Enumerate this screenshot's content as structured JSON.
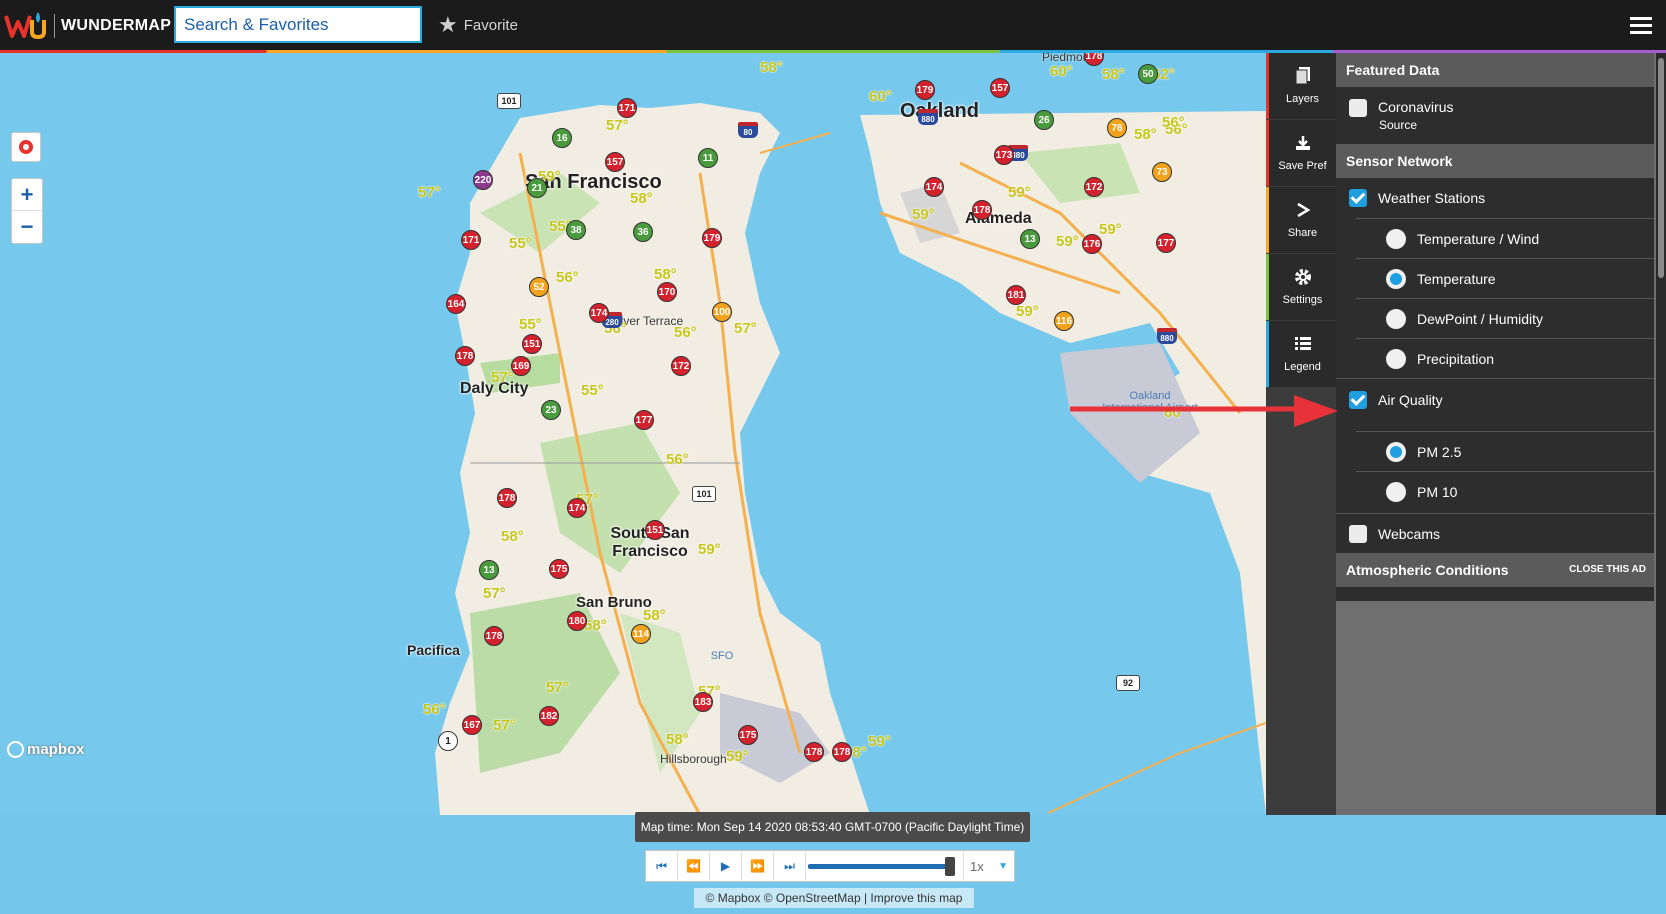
{
  "header": {
    "brand": "WUNDERMAP",
    "search_placeholder": "Search & Favorites",
    "favorite_label": "Favorite"
  },
  "map": {
    "cities": [
      {
        "name": "San Francisco",
        "size": 20
      },
      {
        "name": "Oakland",
        "size": 20
      },
      {
        "name": "Alameda",
        "size": 16
      },
      {
        "name": "Daly City",
        "size": 16
      },
      {
        "name": "South San Francisco",
        "size": 16
      },
      {
        "name": "San Bruno",
        "size": 15
      },
      {
        "name": "Pacifica",
        "size": 14
      }
    ],
    "small_labels": [
      "Silver Terrace",
      "Piedmont",
      "Hillsborough"
    ],
    "airports": [
      "Oakland International Airport",
      "SFO"
    ],
    "markers": [
      {
        "v": "171",
        "c": "red"
      },
      {
        "v": "16",
        "c": "green"
      },
      {
        "v": "157",
        "c": "red"
      },
      {
        "v": "11",
        "c": "green"
      },
      {
        "v": "220",
        "c": "purple"
      },
      {
        "v": "21",
        "c": "green"
      },
      {
        "v": "171",
        "c": "red"
      },
      {
        "v": "38",
        "c": "green"
      },
      {
        "v": "36",
        "c": "green"
      },
      {
        "v": "179",
        "c": "red"
      },
      {
        "v": "52",
        "c": "orange"
      },
      {
        "v": "170",
        "c": "red"
      },
      {
        "v": "164",
        "c": "red"
      },
      {
        "v": "174",
        "c": "red"
      },
      {
        "v": "100",
        "c": "orange"
      },
      {
        "v": "151",
        "c": "red"
      },
      {
        "v": "178",
        "c": "red"
      },
      {
        "v": "169",
        "c": "red"
      },
      {
        "v": "172",
        "c": "red"
      },
      {
        "v": "23",
        "c": "green"
      },
      {
        "v": "177",
        "c": "red"
      },
      {
        "v": "178",
        "c": "red"
      },
      {
        "v": "174",
        "c": "red"
      },
      {
        "v": "151",
        "c": "red"
      },
      {
        "v": "13",
        "c": "green"
      },
      {
        "v": "175",
        "c": "red"
      },
      {
        "v": "180",
        "c": "red"
      },
      {
        "v": "114",
        "c": "orange"
      },
      {
        "v": "178",
        "c": "red"
      },
      {
        "v": "167",
        "c": "red"
      },
      {
        "v": "182",
        "c": "red"
      },
      {
        "v": "183",
        "c": "red"
      },
      {
        "v": "175",
        "c": "red"
      },
      {
        "v": "178",
        "c": "red"
      },
      {
        "v": "178",
        "c": "red"
      },
      {
        "v": "179",
        "c": "red"
      },
      {
        "v": "157",
        "c": "red"
      },
      {
        "v": "178",
        "c": "red"
      },
      {
        "v": "50",
        "c": "green"
      },
      {
        "v": "26",
        "c": "green"
      },
      {
        "v": "76",
        "c": "orange"
      },
      {
        "v": "173",
        "c": "red"
      },
      {
        "v": "73",
        "c": "orange"
      },
      {
        "v": "174",
        "c": "red"
      },
      {
        "v": "178",
        "c": "red"
      },
      {
        "v": "172",
        "c": "red"
      },
      {
        "v": "13",
        "c": "green"
      },
      {
        "v": "176",
        "c": "red"
      },
      {
        "v": "177",
        "c": "red"
      },
      {
        "v": "181",
        "c": "red"
      },
      {
        "v": "116",
        "c": "orange"
      },
      {
        "v": "1",
        "c": "white"
      }
    ],
    "temps": [
      "58°",
      "57°",
      "59°",
      "57°",
      "58°",
      "55°",
      "55°",
      "56°",
      "58°",
      "55°",
      "56°",
      "56°",
      "57°",
      "57°",
      "55°",
      "56°",
      "57°",
      "58°",
      "59°",
      "57°",
      "58°",
      "58°",
      "57°",
      "57°",
      "56°",
      "57°",
      "58°",
      "59°",
      "58°",
      "59°",
      "60°",
      "59°",
      "56°",
      "59°",
      "59°",
      "60°",
      "59°",
      "52°",
      "60°",
      "58°",
      "59°",
      "56°",
      "58°"
    ],
    "highways": [
      "101",
      "101",
      "92"
    ],
    "interstates": [
      "80",
      "280",
      "880",
      "880",
      "880"
    ],
    "mapbox_logo": "mapbox"
  },
  "time": {
    "map_time": "Map time: Mon Sep 14 2020 08:53:40 GMT-0700 (Pacific Daylight Time)",
    "speed": "1x",
    "attribution": "© Mapbox © OpenStreetMap | Improve this map",
    "progress": 1.0
  },
  "tools": [
    {
      "label": "Layers",
      "icon": "layers-icon"
    },
    {
      "label": "Save Pref",
      "icon": "download-icon"
    },
    {
      "label": "Share",
      "icon": "share-icon"
    },
    {
      "label": "Settings",
      "icon": "gear-icon"
    },
    {
      "label": "Legend",
      "icon": "list-icon"
    }
  ],
  "panel": {
    "featured_data": "Featured Data",
    "coronavirus": "Coronavirus",
    "source": "Source",
    "sensor_network": "Sensor Network",
    "weather_stations": "Weather Stations",
    "ws_options": [
      "Temperature / Wind",
      "Temperature",
      "DewPoint / Humidity",
      "Precipitation"
    ],
    "air_quality": "Air Quality",
    "aq_options": [
      "PM 2.5",
      "PM 10"
    ],
    "webcams": "Webcams",
    "atmospheric": "Atmospheric Conditions",
    "close_ad": "CLOSE THIS AD"
  },
  "colors": {
    "red": "#d3222e",
    "green": "#4a9a3e",
    "orange": "#f2a21c",
    "purple": "#8b3a8f",
    "white": "#ffffff",
    "accent": "#1f9fe0"
  }
}
